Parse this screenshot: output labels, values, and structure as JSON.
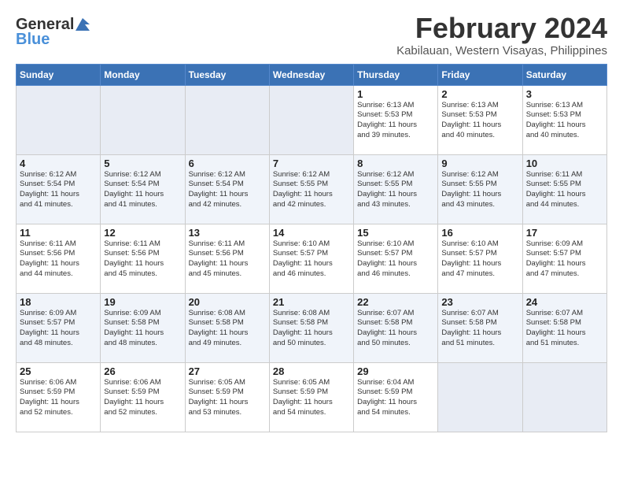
{
  "header": {
    "logo_general": "General",
    "logo_blue": "Blue",
    "month_title": "February 2024",
    "subtitle": "Kabilauan, Western Visayas, Philippines"
  },
  "days_of_week": [
    "Sunday",
    "Monday",
    "Tuesday",
    "Wednesday",
    "Thursday",
    "Friday",
    "Saturday"
  ],
  "weeks": [
    [
      {
        "day": "",
        "info": ""
      },
      {
        "day": "",
        "info": ""
      },
      {
        "day": "",
        "info": ""
      },
      {
        "day": "",
        "info": ""
      },
      {
        "day": "1",
        "info": "Sunrise: 6:13 AM\nSunset: 5:53 PM\nDaylight: 11 hours\nand 39 minutes."
      },
      {
        "day": "2",
        "info": "Sunrise: 6:13 AM\nSunset: 5:53 PM\nDaylight: 11 hours\nand 40 minutes."
      },
      {
        "day": "3",
        "info": "Sunrise: 6:13 AM\nSunset: 5:53 PM\nDaylight: 11 hours\nand 40 minutes."
      }
    ],
    [
      {
        "day": "4",
        "info": "Sunrise: 6:12 AM\nSunset: 5:54 PM\nDaylight: 11 hours\nand 41 minutes."
      },
      {
        "day": "5",
        "info": "Sunrise: 6:12 AM\nSunset: 5:54 PM\nDaylight: 11 hours\nand 41 minutes."
      },
      {
        "day": "6",
        "info": "Sunrise: 6:12 AM\nSunset: 5:54 PM\nDaylight: 11 hours\nand 42 minutes."
      },
      {
        "day": "7",
        "info": "Sunrise: 6:12 AM\nSunset: 5:55 PM\nDaylight: 11 hours\nand 42 minutes."
      },
      {
        "day": "8",
        "info": "Sunrise: 6:12 AM\nSunset: 5:55 PM\nDaylight: 11 hours\nand 43 minutes."
      },
      {
        "day": "9",
        "info": "Sunrise: 6:12 AM\nSunset: 5:55 PM\nDaylight: 11 hours\nand 43 minutes."
      },
      {
        "day": "10",
        "info": "Sunrise: 6:11 AM\nSunset: 5:55 PM\nDaylight: 11 hours\nand 44 minutes."
      }
    ],
    [
      {
        "day": "11",
        "info": "Sunrise: 6:11 AM\nSunset: 5:56 PM\nDaylight: 11 hours\nand 44 minutes."
      },
      {
        "day": "12",
        "info": "Sunrise: 6:11 AM\nSunset: 5:56 PM\nDaylight: 11 hours\nand 45 minutes."
      },
      {
        "day": "13",
        "info": "Sunrise: 6:11 AM\nSunset: 5:56 PM\nDaylight: 11 hours\nand 45 minutes."
      },
      {
        "day": "14",
        "info": "Sunrise: 6:10 AM\nSunset: 5:57 PM\nDaylight: 11 hours\nand 46 minutes."
      },
      {
        "day": "15",
        "info": "Sunrise: 6:10 AM\nSunset: 5:57 PM\nDaylight: 11 hours\nand 46 minutes."
      },
      {
        "day": "16",
        "info": "Sunrise: 6:10 AM\nSunset: 5:57 PM\nDaylight: 11 hours\nand 47 minutes."
      },
      {
        "day": "17",
        "info": "Sunrise: 6:09 AM\nSunset: 5:57 PM\nDaylight: 11 hours\nand 47 minutes."
      }
    ],
    [
      {
        "day": "18",
        "info": "Sunrise: 6:09 AM\nSunset: 5:57 PM\nDaylight: 11 hours\nand 48 minutes."
      },
      {
        "day": "19",
        "info": "Sunrise: 6:09 AM\nSunset: 5:58 PM\nDaylight: 11 hours\nand 48 minutes."
      },
      {
        "day": "20",
        "info": "Sunrise: 6:08 AM\nSunset: 5:58 PM\nDaylight: 11 hours\nand 49 minutes."
      },
      {
        "day": "21",
        "info": "Sunrise: 6:08 AM\nSunset: 5:58 PM\nDaylight: 11 hours\nand 50 minutes."
      },
      {
        "day": "22",
        "info": "Sunrise: 6:07 AM\nSunset: 5:58 PM\nDaylight: 11 hours\nand 50 minutes."
      },
      {
        "day": "23",
        "info": "Sunrise: 6:07 AM\nSunset: 5:58 PM\nDaylight: 11 hours\nand 51 minutes."
      },
      {
        "day": "24",
        "info": "Sunrise: 6:07 AM\nSunset: 5:58 PM\nDaylight: 11 hours\nand 51 minutes."
      }
    ],
    [
      {
        "day": "25",
        "info": "Sunrise: 6:06 AM\nSunset: 5:59 PM\nDaylight: 11 hours\nand 52 minutes."
      },
      {
        "day": "26",
        "info": "Sunrise: 6:06 AM\nSunset: 5:59 PM\nDaylight: 11 hours\nand 52 minutes."
      },
      {
        "day": "27",
        "info": "Sunrise: 6:05 AM\nSunset: 5:59 PM\nDaylight: 11 hours\nand 53 minutes."
      },
      {
        "day": "28",
        "info": "Sunrise: 6:05 AM\nSunset: 5:59 PM\nDaylight: 11 hours\nand 54 minutes."
      },
      {
        "day": "29",
        "info": "Sunrise: 6:04 AM\nSunset: 5:59 PM\nDaylight: 11 hours\nand 54 minutes."
      },
      {
        "day": "",
        "info": ""
      },
      {
        "day": "",
        "info": ""
      }
    ]
  ]
}
